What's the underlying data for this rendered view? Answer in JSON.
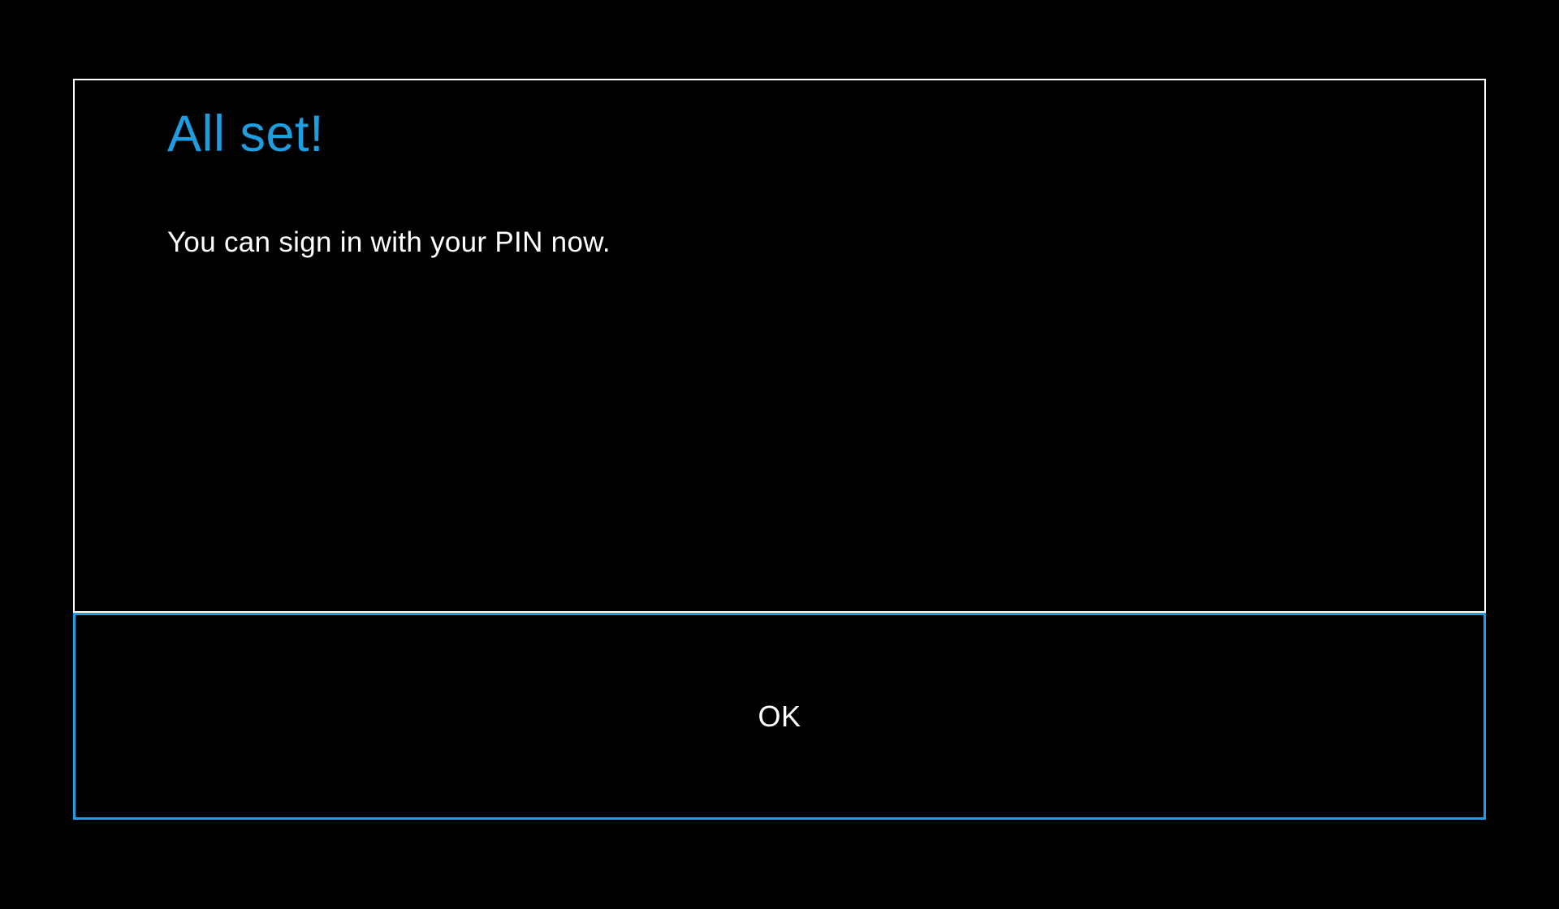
{
  "dialog": {
    "title": "All set!",
    "body": "You can sign in with your PIN now."
  },
  "button": {
    "ok_label": "OK"
  },
  "colors": {
    "accent": "#1e9de0",
    "background": "#000000",
    "text": "#ffffff"
  }
}
